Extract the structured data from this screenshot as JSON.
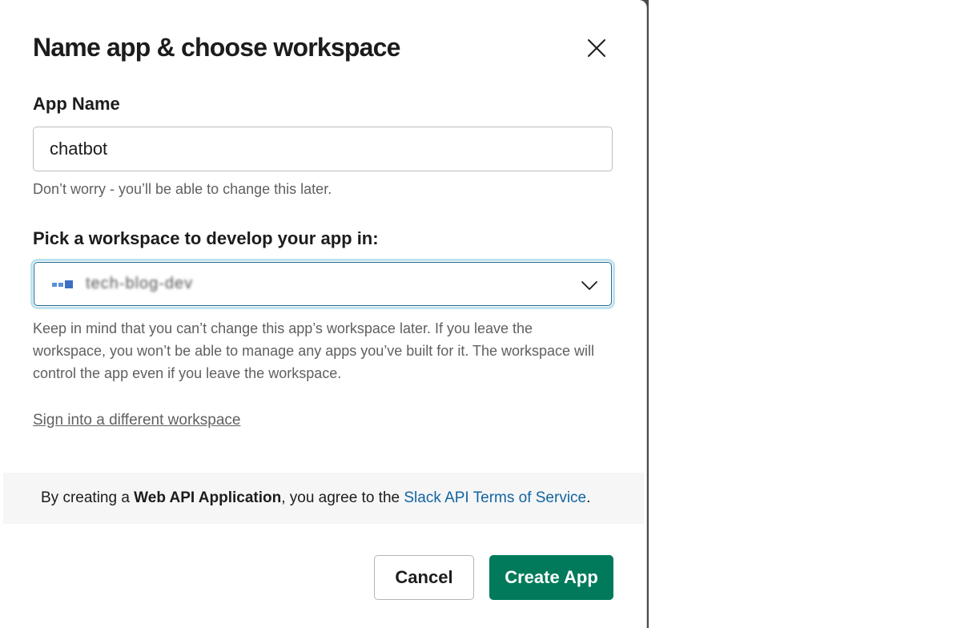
{
  "modal": {
    "title": "Name app & choose workspace",
    "close_icon": "close-icon"
  },
  "app_name": {
    "label": "App Name",
    "value": "chatbot",
    "hint": "Don’t worry - you’ll be able to change this later."
  },
  "workspace": {
    "label": "Pick a workspace to develop your app in:",
    "selected": "tech-blog-dev",
    "icon": "workspace-icon",
    "dropdown_icon": "chevron-down-icon",
    "hint": "Keep in mind that you can’t change this app’s workspace later. If you leave the workspace, you won’t be able to manage any apps you’ve built for it. The workspace will control the app even if you leave the workspace.",
    "switch_link": "Sign into a different workspace"
  },
  "terms": {
    "prefix": "By creating a ",
    "bold": "Web API Application",
    "middle": ", you agree to the ",
    "link": "Slack API Terms of Service",
    "suffix": "."
  },
  "actions": {
    "cancel_label": "Cancel",
    "create_label": "Create App"
  },
  "colors": {
    "primary": "#007a5a",
    "link": "#1264a3",
    "focus_ring": "#bfe2ef"
  }
}
